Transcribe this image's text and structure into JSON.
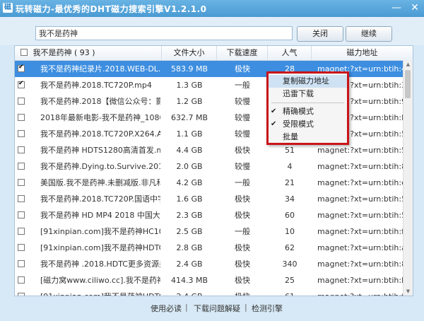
{
  "window": {
    "title": "玩转磁力-最优秀的DHT磁力搜索引擎V1.2.1.0",
    "icon": "app-icon",
    "minimize": "—",
    "close": "✕"
  },
  "search": {
    "value": "我不是药神",
    "close_label": "关闭",
    "continue_label": "继续"
  },
  "columns": {
    "name": "我不是药神 ( 93 )",
    "size": "文件大小",
    "speed": "下载速度",
    "popularity": "人气",
    "magnet": "磁力地址"
  },
  "rows": [
    {
      "checked": true,
      "selected": true,
      "name": "我不是药神纪录片.2018.WEB-DL.1...",
      "size": "583.9 MB",
      "speed": "极快",
      "pop": "28",
      "magnet": "magnet:?xt=urn:btih:4..."
    },
    {
      "checked": true,
      "selected": false,
      "name": "我不是药神.2018.TC720P.mp4",
      "size": "1.3 GB",
      "speed": "一般",
      "pop": "8",
      "magnet": "magnet:?xt=urn:btih:3..."
    },
    {
      "checked": false,
      "selected": false,
      "name": "我不是药神.2018【微信公众号：影...",
      "size": "1.2 GB",
      "speed": "较慢",
      "pop": "6",
      "magnet": "magnet:?xt=urn:btih:9..."
    },
    {
      "checked": false,
      "selected": false,
      "name": "2018年最新电影-我不是药神_1080P...",
      "size": "632.7 MB",
      "speed": "较慢",
      "pop": "8",
      "magnet": "magnet:?xt=urn:btih:P..."
    },
    {
      "checked": false,
      "selected": false,
      "name": "我不是药神.2018.TC720P.X264.AA...",
      "size": "1.1 GB",
      "speed": "较慢",
      "pop": "8",
      "magnet": "magnet:?xt=urn:btih:5..."
    },
    {
      "checked": false,
      "selected": false,
      "name": "我不是药神 HDTS1280高清首发.mp4",
      "size": "4.4 GB",
      "speed": "极快",
      "pop": "51",
      "magnet": "magnet:?xt=urn:btih:5..."
    },
    {
      "checked": false,
      "selected": false,
      "name": "我不是药神.Dying.to.Survive.2018....",
      "size": "2.0 GB",
      "speed": "较慢",
      "pop": "4",
      "magnet": "magnet:?xt=urn:btih:8..."
    },
    {
      "checked": false,
      "selected": false,
      "name": "美国版.我不是药神.未删减版.非凡科...",
      "size": "4.2 GB",
      "speed": "一般",
      "pop": "21",
      "magnet": "magnet:?xt=urn:btih:e..."
    },
    {
      "checked": false,
      "selected": false,
      "name": "我不是药神.2018.TC720P.国语中字....",
      "size": "1.6 GB",
      "speed": "极快",
      "pop": "34",
      "magnet": "magnet:?xt=urn:btih:5..."
    },
    {
      "checked": false,
      "selected": false,
      "name": "我不是药神 HD MP4 2018 中国大...",
      "size": "2.3 GB",
      "speed": "极快",
      "pop": "60",
      "magnet": "magnet:?xt=urn:btih:5..."
    },
    {
      "checked": false,
      "selected": false,
      "name": "[91xinpian.com]我不是药神HC108...",
      "size": "2.5 GB",
      "speed": "一般",
      "pop": "10",
      "magnet": "magnet:?xt=urn:btih:f..."
    },
    {
      "checked": false,
      "selected": false,
      "name": "[91xinpian.com]我不是药神HDTC1...",
      "size": "2.8 GB",
      "speed": "极快",
      "pop": "62",
      "magnet": "magnet:?xt=urn:btih:a..."
    },
    {
      "checked": false,
      "selected": false,
      "name": "我不是药神 .2018.HDTC更多资源关...",
      "size": "2.4 GB",
      "speed": "极快",
      "pop": "340",
      "magnet": "magnet:?xt=urn:btih:8..."
    },
    {
      "checked": false,
      "selected": false,
      "name": "[磁力窝www.ciliwo.cc].我不是药神...",
      "size": "414.3 MB",
      "speed": "极快",
      "pop": "25",
      "magnet": "magnet:?xt=urn:btih:b..."
    },
    {
      "checked": false,
      "selected": false,
      "name": "[91xinpian.com]我不是药神HDTC1...",
      "size": "2.4 GB",
      "speed": "极快",
      "pop": "61",
      "magnet": "magnet:?xt=urn:btih:f..."
    }
  ],
  "context_menu": {
    "items": [
      {
        "label": "复制磁力地址",
        "checked": false
      },
      {
        "label": "迅雷下载",
        "checked": false
      },
      {
        "label": "精确模式",
        "checked": true
      },
      {
        "label": "受限模式",
        "checked": true
      },
      {
        "label": "批量",
        "checked": false
      }
    ]
  },
  "footer": {
    "links": [
      "使用必读",
      "下载问题解疑",
      "检测引擎"
    ],
    "separator": "|"
  },
  "colors": {
    "selected_row": "#3d8ee0",
    "menu_highlight_border": "#c9141a",
    "titlebar": "#4a9ad3"
  }
}
